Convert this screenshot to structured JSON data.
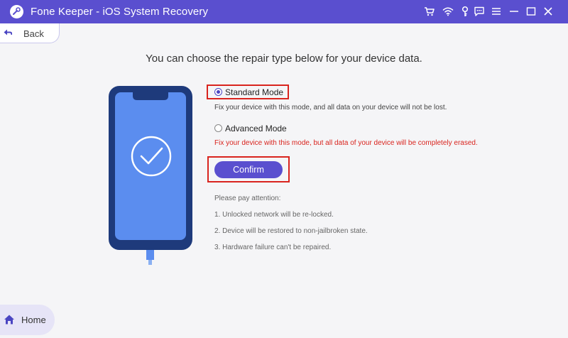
{
  "window": {
    "title": "Fone Keeper - iOS System Recovery",
    "accent": "#5a4fcf",
    "icons": [
      "cart-icon",
      "wifi-icon",
      "key-icon",
      "feedback-icon",
      "menu-icon",
      "minimize-icon",
      "maximize-icon",
      "close-icon"
    ]
  },
  "nav": {
    "back_label": "Back",
    "home_label": "Home"
  },
  "main": {
    "heading": "You can choose the repair type below for your device data.",
    "options": [
      {
        "label": "Standard Mode",
        "selected": true,
        "description": "Fix your device with this mode, and all data on your device will not be lost."
      },
      {
        "label": "Advanced Mode",
        "selected": false,
        "description": "Fix your device with this mode, but all data of your device will be completely erased."
      }
    ],
    "confirm_label": "Confirm",
    "attention_title": "Please pay attention:",
    "notes": [
      "1. Unlocked network will be re-locked.",
      "2. Device will be restored to non-jailbroken state.",
      "3. Hardware failure can't be repaired."
    ],
    "colors": {
      "warning": "#d9241e",
      "highlight_box": "#d9241e",
      "phone_screen": "#5b8def"
    }
  }
}
